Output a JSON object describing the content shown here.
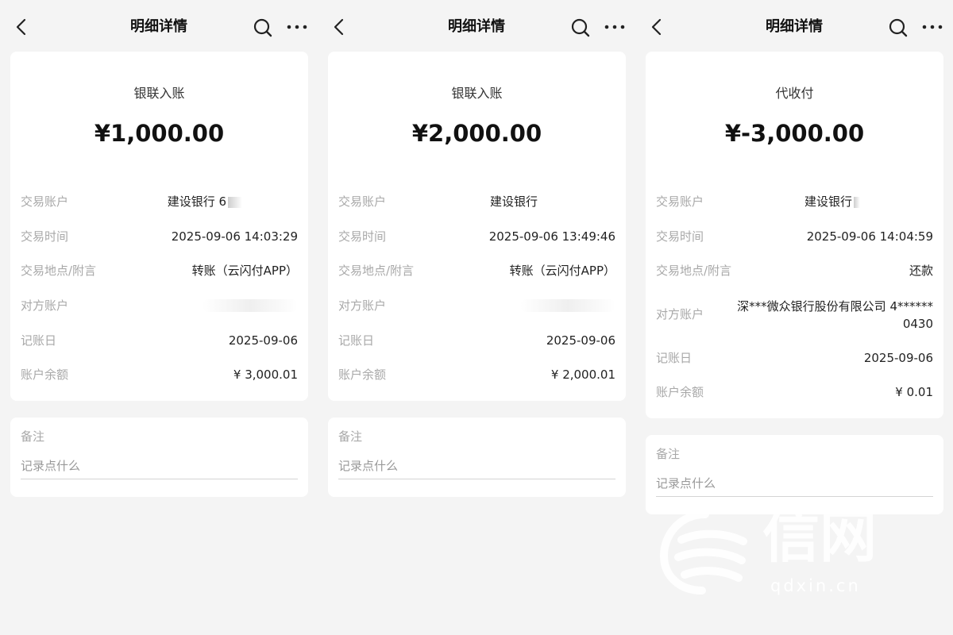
{
  "nav": {
    "title": "明细详情"
  },
  "labels": {
    "account": "交易账户",
    "time": "交易时间",
    "location": "交易地点/附言",
    "counterparty": "对方账户",
    "posting_date": "记账日",
    "balance": "账户余额",
    "note": "备注",
    "note_placeholder": "记录点什么"
  },
  "panels": [
    {
      "txn_type": "银联入账",
      "amount": "¥1,000.00",
      "account": "建设银行 6",
      "time": "2025-09-06 14:03:29",
      "location": "转账（云闪付APP）",
      "counterparty": "",
      "posting_date": "2025-09-06",
      "balance": "¥ 3,000.01"
    },
    {
      "txn_type": "银联入账",
      "amount": "¥2,000.00",
      "account": "建设银行",
      "time": "2025-09-06 13:49:46",
      "location": "转账（云闪付APP）",
      "counterparty": "",
      "posting_date": "2025-09-06",
      "balance": "¥ 2,000.01"
    },
    {
      "txn_type": "代收付",
      "amount": "¥-3,000.00",
      "account": "建设银行",
      "time": "2025-09-06 14:04:59",
      "location": "还款",
      "counterparty_line1": "深***微众银行股份有限公司 4******",
      "counterparty_line2": "0430",
      "posting_date": "2025-09-06",
      "balance": "¥ 0.01"
    }
  ],
  "watermark": {
    "chars": "信网",
    "site": "qdxin.cn"
  },
  "icons": {
    "back": "chevron-left-icon",
    "search": "search-icon",
    "more": "more-dots-icon"
  },
  "colors": {
    "background": "#f4f4f4",
    "card": "#ffffff",
    "label": "#a8a8a8",
    "text": "#222222"
  }
}
